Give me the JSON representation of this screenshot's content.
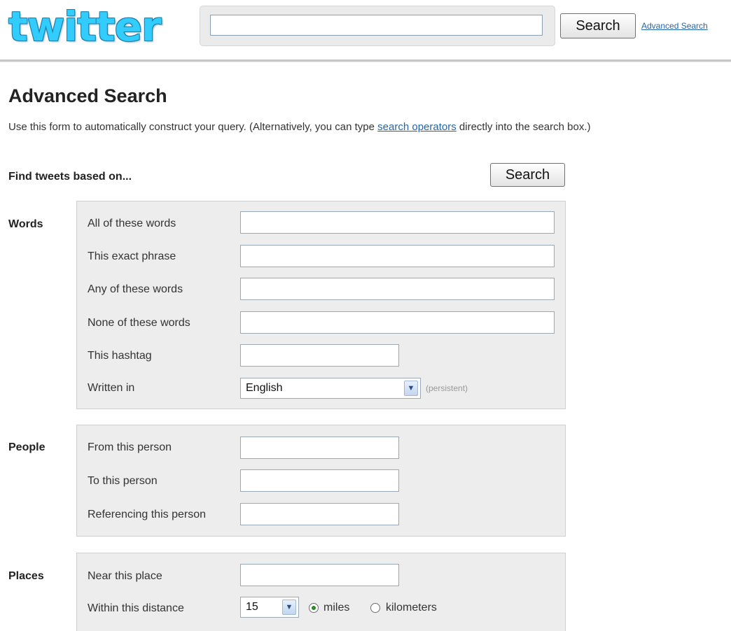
{
  "header": {
    "logo_text": "twitter",
    "search_value": "",
    "search_button": "Search",
    "advanced_link": "Advanced Search"
  },
  "page": {
    "title": "Advanced Search",
    "intro_before": "Use this form to automatically construct your query. (Alternatively, you can type ",
    "intro_link": "search operators",
    "intro_after": " directly into the search box.)",
    "find_label": "Find tweets based on...",
    "search_button": "Search"
  },
  "words": {
    "section": "Words",
    "all_label": "All of these words",
    "exact_label": "This exact phrase",
    "any_label": "Any of these words",
    "none_label": "None of these words",
    "hashtag_label": "This hashtag",
    "lang_label": "Written in",
    "lang_value": "English",
    "lang_hint": "(persistent)"
  },
  "people": {
    "section": "People",
    "from_label": "From this person",
    "to_label": "To this person",
    "ref_label": "Referencing this person"
  },
  "places": {
    "section": "Places",
    "near_label": "Near this place",
    "within_label": "Within this distance",
    "distance_value": "15",
    "unit_miles": "miles",
    "unit_km": "kilometers",
    "selected_unit": "miles"
  },
  "colors": {
    "logo": "#33ccff",
    "link": "#2266aa",
    "panel": "#ededed"
  },
  "icons": {
    "dropdown": "chevron-down-icon",
    "radio": "radio-icon"
  }
}
